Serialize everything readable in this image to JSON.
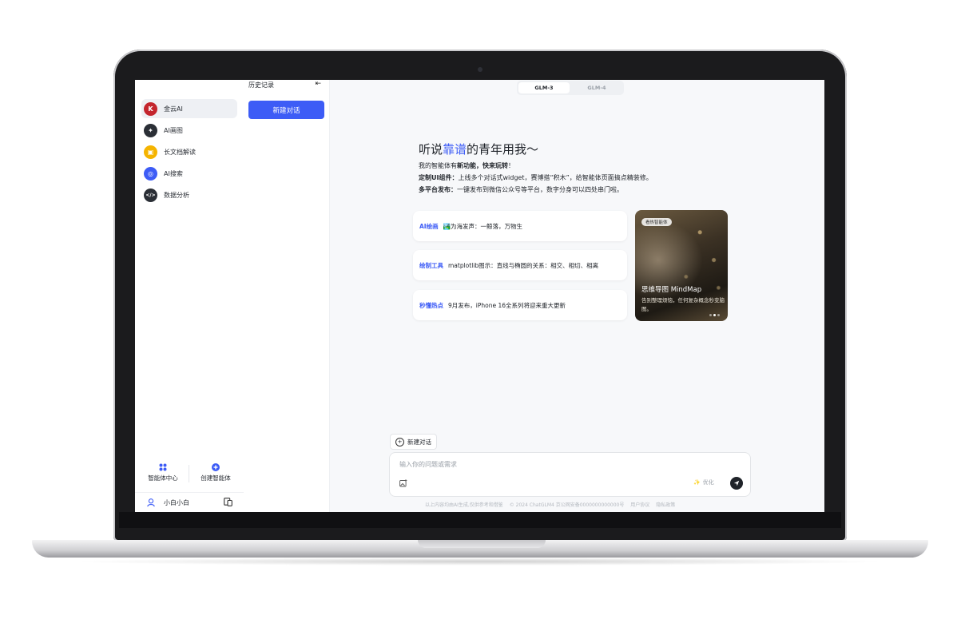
{
  "nav": {
    "items": [
      {
        "label": "金云AI",
        "icon": "kingcloud-logo-icon",
        "color": "#c4262e",
        "active": true
      },
      {
        "label": "AI画图",
        "icon": "ai-draw-icon",
        "color": "#2b2f36"
      },
      {
        "label": "长文档解读",
        "icon": "document-read-icon",
        "color": "#f5b400"
      },
      {
        "label": "AI搜索",
        "icon": "ai-search-icon",
        "color": "#3d5cf6"
      },
      {
        "label": "数据分析",
        "icon": "code-icon",
        "color": "#2b2f36"
      }
    ],
    "agent_center": "智能体中心",
    "create_agent": "创建智能体",
    "user_name": "小白小白"
  },
  "history": {
    "title": "历史记录",
    "new_chat": "新建对话"
  },
  "models": [
    "GLM-3",
    "GLM-4"
  ],
  "hero": {
    "title_pre": "听说",
    "title_hl": "靠谱",
    "title_post": "的青年用我～",
    "line1_pre": "我的智能体有",
    "line1_bold": "新功能，快来玩转",
    "line1_post": "！",
    "line2_bold": "定制UI组件：",
    "line2_text": "上线多个对话式widget，赛博搭“积木”，给智能体页面搞点精装修。",
    "line3_bold": "多平台发布：",
    "line3_text": "一键发布到微信公众号等平台，数字分身可以四处串门啦。"
  },
  "prompts": [
    {
      "tag": "AI绘画",
      "text": "🏞️为海发声：一鲸落，万物生"
    },
    {
      "tag": "绘制工具",
      "text": "matplotlib图示：直线与椭圆的关系：相交、相切、相离"
    },
    {
      "tag": "秒懂热点",
      "text": "9月发布，iPhone 16全系列将迎来重大更新"
    }
  ],
  "feature": {
    "badge": "看热智能体",
    "title": "思维导图 MindMap",
    "desc": "告别整理烦恼，任何复杂概念秒变脑图。"
  },
  "composer": {
    "new_chat": "新建对话",
    "placeholder": "输入你的问题或需求",
    "optimize": "优化"
  },
  "footer": {
    "disclaimer": "以上内容均由AI生成,仅供参考和借鉴",
    "copyright": "© 2024 ChatGLM4 京公网安备0000000000000号",
    "terms": "用户协议",
    "privacy": "隐私政策"
  },
  "colors": {
    "accent": "#3d5cf6",
    "text": "#1f2329"
  }
}
